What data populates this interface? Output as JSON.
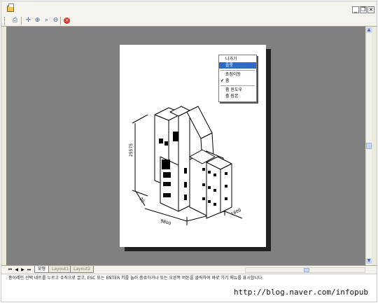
{
  "window": {
    "icon": "document-icon",
    "controls": [
      "_",
      "❐",
      "×"
    ]
  },
  "toolbar": {
    "buttons": [
      {
        "name": "print-icon",
        "glyph": "⎙"
      },
      {
        "name": "pan-icon",
        "glyph": "✛"
      },
      {
        "name": "zoom-realtime-icon",
        "glyph": "⊕"
      },
      {
        "name": "zoom-window-icon",
        "glyph": "⌕"
      },
      {
        "name": "zoom-previous-icon",
        "glyph": "⊖"
      },
      {
        "name": "close-preview-icon",
        "glyph": "×"
      }
    ]
  },
  "context_menu": {
    "items": [
      "나가기",
      "플롯",
      "초점이동",
      "줌",
      "줌 윈도우",
      "줌 원본"
    ],
    "active_item": "플롯",
    "checked_item": "줌"
  },
  "drawing": {
    "dimensions": [
      "25575",
      "9800",
      "20",
      "1800"
    ]
  },
  "tabs": [
    "모형",
    "Layout1",
    "Layout2"
  ],
  "active_tab": "모형",
  "command_line": "종이레인 선택 네트를 누르고 수직으로 끌고, ESC 또는 ENTER 키를 눌러 종료하거나 또는 오른쪽 버튼을 클릭하여 바로 가기 메뉴를 표시합니다.",
  "watermark": "http://blog.naver.com/infopub",
  "colors": {
    "workspace": "#808080",
    "highlight": "#316ac5",
    "chrome": "#ece9d8"
  }
}
